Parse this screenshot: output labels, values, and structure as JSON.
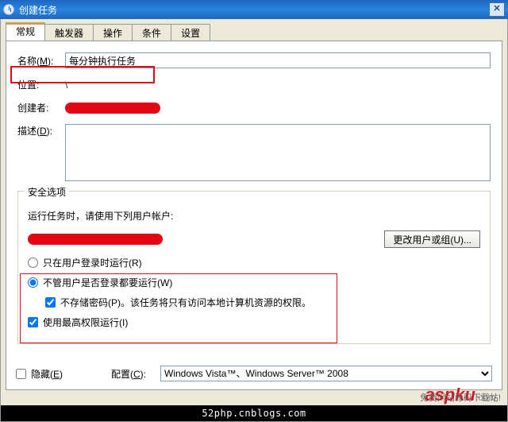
{
  "title": "创建任务",
  "tabs": {
    "general": "常规",
    "triggers": "触发器",
    "actions": "操作",
    "conditions": "条件",
    "settings": "设置"
  },
  "general": {
    "name_label_prefix": "名称(",
    "name_label_key": "M",
    "name_label_suffix": "):",
    "name_value": "每分钟执行任务",
    "location_label": "位置:",
    "location_value": "\\",
    "author_label": "创建者:",
    "description_label_prefix": "描述(",
    "description_label_key": "D",
    "description_label_suffix": "):",
    "description_value": ""
  },
  "security": {
    "legend": "安全选项",
    "account_prefix": "运行任务时，请使用下列用户帐户:",
    "change_user_btn": "更改用户或组(U)...",
    "only_logged_on": "只在用户登录时运行(R)",
    "whether_logged": "不管用户是否登录都要运行(W)",
    "no_store_pw": "不存储密码(P)。",
    "no_store_pw_suffix": "该任务将只有访问本地计算机资源的权限。",
    "highest_priv": "使用最高权限运行(I)",
    "selected_mode": "whether",
    "no_store_pw_checked": true,
    "highest_priv_checked": true
  },
  "footer_row": {
    "hidden_prefix": "隐藏(",
    "hidden_key": "E",
    "hidden_suffix": ")",
    "hidden_checked": false,
    "config_label_prefix": "配置(",
    "config_label_key": "C",
    "config_label_suffix": "):",
    "config_value": "Windows Vista™、Windows Server™ 2008"
  },
  "watermark": {
    "brand": "aspku",
    "ext": ".com"
  },
  "blog": "52php.cnblogs.com",
  "subfooter": "免费网站源码下载站!"
}
